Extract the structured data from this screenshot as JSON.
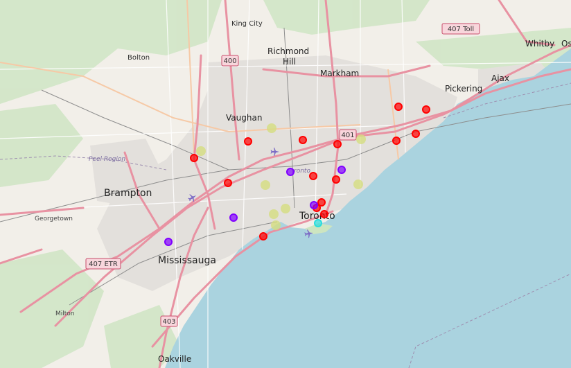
{
  "map": {
    "colors": {
      "land": "#f2efe9",
      "water": "#aad3df",
      "highway": "#e892a2",
      "highway_casing": "#c84e6c",
      "trunk": "#f6c9a6",
      "rail": "#8d8d8d",
      "forest": "#cfe5c4",
      "urban": "#e3e0dc"
    },
    "places": [
      {
        "id": "king-city",
        "name": "King City",
        "size": "small"
      },
      {
        "id": "bolton",
        "name": "Bolton",
        "size": "small"
      },
      {
        "id": "richmond-hill",
        "name": "Richmond Hill",
        "size": "mid"
      },
      {
        "id": "markham",
        "name": "Markham",
        "size": "mid"
      },
      {
        "id": "whitby",
        "name": "Whitby",
        "size": "mid"
      },
      {
        "id": "oshawa",
        "name": "Os",
        "size": "mid"
      },
      {
        "id": "ajax",
        "name": "Ajax",
        "size": "mid"
      },
      {
        "id": "pickering",
        "name": "Pickering",
        "size": "mid"
      },
      {
        "id": "vaughan",
        "name": "Vaughan",
        "size": "mid"
      },
      {
        "id": "brampton",
        "name": "Brampton",
        "size": "big"
      },
      {
        "id": "georgetown",
        "name": "Georgetown",
        "size": "tiny"
      },
      {
        "id": "mississauga",
        "name": "Mississauga",
        "size": "big"
      },
      {
        "id": "toronto",
        "name": "Toronto",
        "size": "big"
      },
      {
        "id": "milton",
        "name": "Milton",
        "size": "tiny"
      },
      {
        "id": "oakville",
        "name": "Oakville",
        "size": "mid"
      },
      {
        "id": "toronto-district",
        "name": "ronto",
        "size": "region"
      }
    ],
    "region_label": "Peel Region",
    "shields": [
      {
        "id": "hwy-407-toll",
        "label": "407 Toll"
      },
      {
        "id": "hwy-400",
        "label": "400"
      },
      {
        "id": "hwy-401",
        "label": "401"
      },
      {
        "id": "hwy-407-etr",
        "label": "407 ETR"
      },
      {
        "id": "hwy-403",
        "label": "403"
      }
    ],
    "markers": [
      {
        "id": "m1",
        "cluster": "red",
        "color": "#ff0000"
      },
      {
        "id": "m2",
        "cluster": "red",
        "color": "#ff0000"
      },
      {
        "id": "m3",
        "cluster": "red",
        "color": "#ff0000"
      },
      {
        "id": "m4",
        "cluster": "red",
        "color": "#ff0000"
      },
      {
        "id": "m5",
        "cluster": "red",
        "color": "#ff0000"
      },
      {
        "id": "m6",
        "cluster": "red",
        "color": "#ff0000"
      },
      {
        "id": "m7",
        "cluster": "red",
        "color": "#ff0000"
      },
      {
        "id": "m8",
        "cluster": "red",
        "color": "#ff0000"
      },
      {
        "id": "m9",
        "cluster": "red",
        "color": "#ff0000"
      },
      {
        "id": "m10",
        "cluster": "red",
        "color": "#ff0000"
      },
      {
        "id": "m11",
        "cluster": "red",
        "color": "#ff0000"
      },
      {
        "id": "m12",
        "cluster": "red",
        "color": "#ff0000"
      },
      {
        "id": "m13",
        "cluster": "red",
        "color": "#ff0000"
      },
      {
        "id": "m14",
        "cluster": "red",
        "color": "#ff0000"
      },
      {
        "id": "m15",
        "cluster": "red",
        "color": "#ff0000"
      },
      {
        "id": "m16",
        "cluster": "purple",
        "color": "#8000ff"
      },
      {
        "id": "m17",
        "cluster": "purple",
        "color": "#8000ff"
      },
      {
        "id": "m18",
        "cluster": "purple",
        "color": "#8000ff"
      },
      {
        "id": "m19",
        "cluster": "purple",
        "color": "#8000ff"
      },
      {
        "id": "m20",
        "cluster": "purple",
        "color": "#8000ff"
      },
      {
        "id": "m21",
        "cluster": "cyan",
        "color": "#2adddd"
      },
      {
        "id": "m22",
        "cluster": "khaki",
        "color": "#d4dd80"
      },
      {
        "id": "m23",
        "cluster": "khaki",
        "color": "#d4dd80"
      },
      {
        "id": "m24",
        "cluster": "khaki",
        "color": "#d4dd80"
      },
      {
        "id": "m25",
        "cluster": "khaki",
        "color": "#d4dd80"
      },
      {
        "id": "m26",
        "cluster": "khaki",
        "color": "#d4dd80"
      },
      {
        "id": "m27",
        "cluster": "khaki",
        "color": "#d4dd80"
      },
      {
        "id": "m28",
        "cluster": "khaki",
        "color": "#d4dd80"
      },
      {
        "id": "m29",
        "cluster": "khaki",
        "color": "#d4dd80"
      }
    ],
    "icons": [
      {
        "id": "airport-pearson",
        "name": "airport-icon"
      },
      {
        "id": "airport-downsview",
        "name": "airport-icon"
      },
      {
        "id": "airport-billy-bishop",
        "name": "airport-icon"
      }
    ]
  }
}
